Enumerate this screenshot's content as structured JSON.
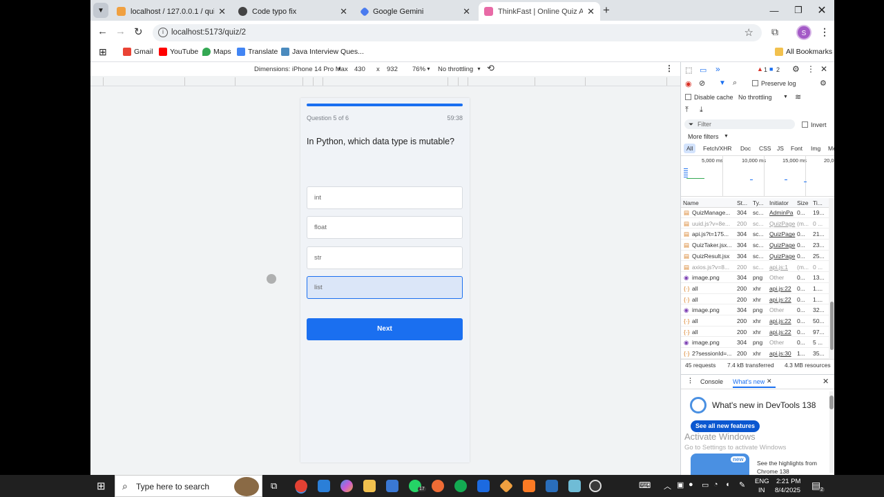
{
  "tabs": [
    {
      "title": "localhost / 127.0.0.1 / quizsyste",
      "color": "#f0a040"
    },
    {
      "title": "Code typo fix",
      "color": "#444"
    },
    {
      "title": "Google Gemini",
      "color": "#4a7bef"
    },
    {
      "title": "ThinkFast | Online Quiz App",
      "color": "#e86aa6"
    }
  ],
  "toolbar": {
    "url": "localhost:5173/quiz/2",
    "profile": "S"
  },
  "bookmarks": [
    {
      "label": "Gmail",
      "color": "#ea4335"
    },
    {
      "label": "YouTube",
      "color": "#ff0000"
    },
    {
      "label": "Maps",
      "color": "#34a853"
    },
    {
      "label": "Translate",
      "color": "#4285f4"
    },
    {
      "label": "Java Interview Ques...",
      "color": "#4b8bbe"
    }
  ],
  "all_bookmarks": "All Bookmarks",
  "device_toolbar": {
    "dimensions_label": "Dimensions: iPhone 14 Pro Max",
    "width": "430",
    "x": "x",
    "height": "932",
    "zoom": "76%",
    "throttle": "No throttling"
  },
  "quiz": {
    "progress": 1.0,
    "question_number": "Question 5 of 6",
    "timer": "59:38",
    "question": "In Python, which data type is mutable?",
    "options": [
      "int",
      "float",
      "str",
      "list"
    ],
    "selected_index": 3,
    "next_label": "Next"
  },
  "devtools": {
    "issues_warn": "1",
    "issues_info": "2",
    "preserve_log": "Preserve log",
    "disable_cache": "Disable cache",
    "no_throttling": "No throttling",
    "filter_placeholder": "Filter",
    "invert": "Invert",
    "more_filters": "More filters",
    "filter_chips": [
      "All",
      "Fetch/XHR",
      "Doc",
      "CSS",
      "JS",
      "Font",
      "Img",
      "Me"
    ],
    "timeline_ticks": [
      "5,000 ms",
      "10,000 ms",
      "15,000 ms",
      "20,0"
    ],
    "columns": [
      "Name",
      "St...",
      "Ty...",
      "Initiator",
      "Size",
      "Ti..."
    ],
    "rows": [
      {
        "name": "QuizManage...",
        "status": "304",
        "type": "sc...",
        "initiator": "AdminPa",
        "size": "0...",
        "time": "19..."
      },
      {
        "name": "uuid.js?v=8e...",
        "status": "200",
        "type": "sc...",
        "initiator": "QuizPage",
        "size": "(m...",
        "time": "0 ..."
      },
      {
        "name": "api.js?t=175...",
        "status": "304",
        "type": "sc...",
        "initiator": "QuizPage",
        "size": "0...",
        "time": "21..."
      },
      {
        "name": "QuizTaker.jsx...",
        "status": "304",
        "type": "sc...",
        "initiator": "QuizPage",
        "size": "0...",
        "time": "23..."
      },
      {
        "name": "QuizResult.jsx",
        "status": "304",
        "type": "sc...",
        "initiator": "QuizPage",
        "size": "0...",
        "time": "25..."
      },
      {
        "name": "axios.js?v=8...",
        "status": "200",
        "type": "sc...",
        "initiator": "api.js:1",
        "size": "(m...",
        "time": "0 ..."
      },
      {
        "name": "image.png",
        "status": "304",
        "type": "png",
        "initiator": "Other",
        "size": "0...",
        "time": "13..."
      },
      {
        "name": "all",
        "status": "200",
        "type": "xhr",
        "initiator": "api.js:22",
        "size": "0...",
        "time": "1...."
      },
      {
        "name": "all",
        "status": "200",
        "type": "xhr",
        "initiator": "api.js:22",
        "size": "0...",
        "time": "1...."
      },
      {
        "name": "image.png",
        "status": "304",
        "type": "png",
        "initiator": "Other",
        "size": "0...",
        "time": "32..."
      },
      {
        "name": "all",
        "status": "200",
        "type": "xhr",
        "initiator": "api.js:22",
        "size": "0...",
        "time": "50..."
      },
      {
        "name": "all",
        "status": "200",
        "type": "xhr",
        "initiator": "api.js:22",
        "size": "0...",
        "time": "97..."
      },
      {
        "name": "image.png",
        "status": "304",
        "type": "png",
        "initiator": "Other",
        "size": "0...",
        "time": "5 ..."
      },
      {
        "name": "2?sessionId=...",
        "status": "200",
        "type": "xhr",
        "initiator": "api.js:30",
        "size": "1...",
        "time": "35..."
      }
    ],
    "summary": {
      "requests": "45 requests",
      "transferred": "7.4 kB transferred",
      "resources": "4.3 MB resources"
    },
    "drawer_tabs": [
      "Console",
      "What's new"
    ],
    "whatsnew_title": "What's new in DevTools 138",
    "see_features": "See all new features",
    "activate_title": "Activate Windows",
    "activate_sub": "Go to Settings to activate Windows",
    "new_badge": "new",
    "highlights": "See the highlights from Chrome 138"
  },
  "taskbar": {
    "search_placeholder": "Type here to search",
    "lang1": "ENG",
    "lang2": "IN",
    "time": "2:21 PM",
    "date": "8/4/2025",
    "whatsapp_badge": "17",
    "notif_badge": "2"
  }
}
